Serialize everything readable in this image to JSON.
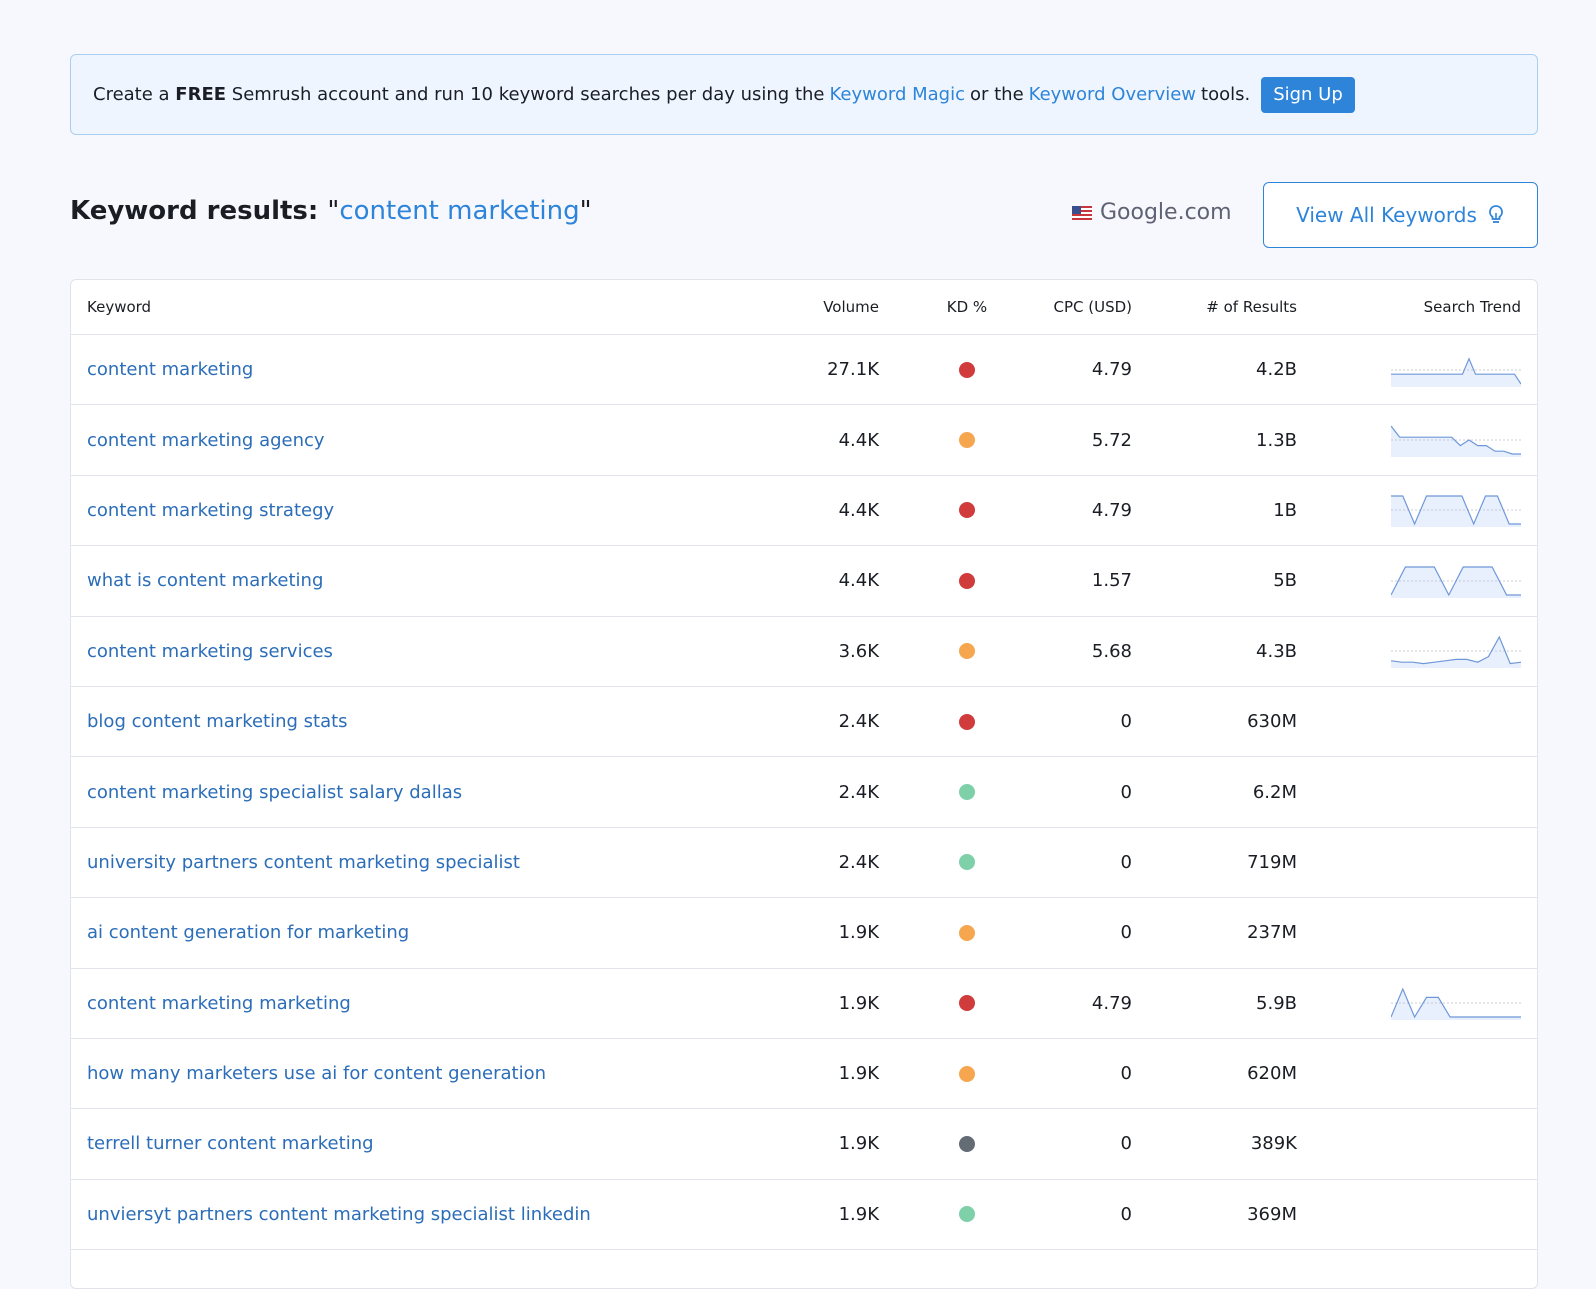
{
  "banner": {
    "pre": "Create a",
    "free": "FREE",
    "mid": "Semrush account and run 10 keyword searches per day using the",
    "link1": "Keyword Magic",
    "or": "or the",
    "link2": "Keyword Overview",
    "post": "tools.",
    "signup": "Sign Up"
  },
  "heading": {
    "label": "Keyword results:",
    "term": "content marketing"
  },
  "database": "Google.com",
  "view_all": "View All Keywords",
  "columns": {
    "keyword": "Keyword",
    "volume": "Volume",
    "kd": "KD %",
    "cpc": "CPC (USD)",
    "results": "# of Results",
    "trend": "Search Trend"
  },
  "colors": {
    "red": "#d03b3b",
    "orange": "#f7a650",
    "green": "#7dd0a8",
    "gray": "#636b74"
  },
  "rows": [
    {
      "keyword": "content marketing",
      "volume": "27.1K",
      "kd": "red",
      "cpc": "4.79",
      "results": "4.2B",
      "trend": [
        0.35,
        0.35,
        0.35,
        0.35,
        0.35,
        0.35,
        0.35,
        0.35,
        0.35,
        0.35,
        0.35,
        0.35,
        0.9,
        0.35,
        0.35,
        0.35,
        0.35,
        0.35,
        0.35,
        0.35,
        0.0
      ]
    },
    {
      "keyword": "content marketing agency",
      "volume": "4.4K",
      "kd": "orange",
      "cpc": "5.72",
      "results": "1.3B",
      "trend": [
        1.0,
        0.6,
        0.6,
        0.6,
        0.6,
        0.6,
        0.6,
        0.6,
        0.3,
        0.5,
        0.3,
        0.3,
        0.1,
        0.1,
        0.0,
        0.0
      ]
    },
    {
      "keyword": "content marketing strategy",
      "volume": "4.4K",
      "kd": "red",
      "cpc": "4.79",
      "results": "1B",
      "trend": [
        1.0,
        1.0,
        0.0,
        1.0,
        1.0,
        1.0,
        1.0,
        0.0,
        1.0,
        1.0,
        0.0,
        0.0
      ]
    },
    {
      "keyword": "what is content marketing",
      "volume": "4.4K",
      "kd": "red",
      "cpc": "1.57",
      "results": "5B",
      "trend": [
        0.0,
        1.0,
        1.0,
        1.0,
        0.0,
        1.0,
        1.0,
        1.0,
        0.0,
        0.0
      ]
    },
    {
      "keyword": "content marketing services",
      "volume": "3.6K",
      "kd": "orange",
      "cpc": "5.68",
      "results": "4.3B",
      "trend": [
        0.15,
        0.1,
        0.1,
        0.05,
        0.1,
        0.15,
        0.2,
        0.2,
        0.1,
        0.3,
        1.0,
        0.05,
        0.1
      ]
    },
    {
      "keyword": "blog content marketing stats",
      "volume": "2.4K",
      "kd": "red",
      "cpc": "0",
      "results": "630M",
      "trend": []
    },
    {
      "keyword": "content marketing specialist salary dallas",
      "volume": "2.4K",
      "kd": "green",
      "cpc": "0",
      "results": "6.2M",
      "trend": []
    },
    {
      "keyword": "university partners content marketing specialist",
      "volume": "2.4K",
      "kd": "green",
      "cpc": "0",
      "results": "719M",
      "trend": []
    },
    {
      "keyword": "ai content generation for marketing",
      "volume": "1.9K",
      "kd": "orange",
      "cpc": "0",
      "results": "237M",
      "trend": []
    },
    {
      "keyword": "content marketing marketing",
      "volume": "1.9K",
      "kd": "red",
      "cpc": "4.79",
      "results": "5.9B",
      "trend": [
        0.0,
        1.0,
        0.0,
        0.7,
        0.7,
        0.0,
        0.0,
        0.0,
        0.0,
        0.0,
        0.0,
        0.0
      ]
    },
    {
      "keyword": "how many marketers use ai for content generation",
      "volume": "1.9K",
      "kd": "orange",
      "cpc": "0",
      "results": "620M",
      "trend": []
    },
    {
      "keyword": "terrell turner content marketing",
      "volume": "1.9K",
      "kd": "gray",
      "cpc": "0",
      "results": "389K",
      "trend": []
    },
    {
      "keyword": "unviersyt partners content marketing specialist linkedin",
      "volume": "1.9K",
      "kd": "green",
      "cpc": "0",
      "results": "369M",
      "trend": []
    }
  ]
}
